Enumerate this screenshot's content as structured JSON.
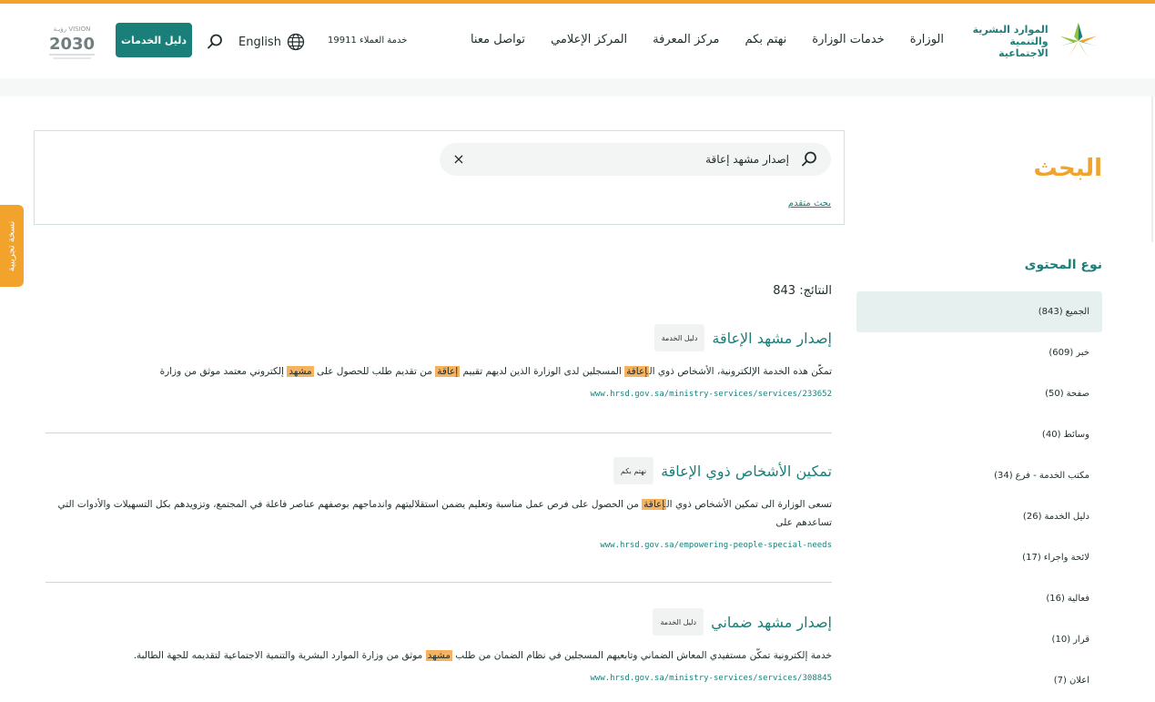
{
  "colors": {
    "accent": "#f2a32c",
    "brand": "#1b7f79",
    "highlight": "#f5b25f"
  },
  "header": {
    "logo_line1": "الموارد البشرية",
    "logo_line2": "والتنمية الاجتماعية",
    "nav": [
      "الوزارة",
      "خدمات الوزارة",
      "نهتم بكم",
      "مركز المعرفة",
      "المركز الإعلامي",
      "تواصل معنا"
    ],
    "customer_service": "خدمة العملاء 19911",
    "language": "English",
    "services_button": "دليل الخدمات",
    "vision_top": "VISION رؤيـة",
    "vision_year": "2030"
  },
  "sidebar": {
    "title": "البحث",
    "filter_title": "نوع المحتوى",
    "filters": [
      {
        "label": "الجميع",
        "count": "(843)"
      },
      {
        "label": "خبر",
        "count": "(609)"
      },
      {
        "label": "صفحة",
        "count": "(50)"
      },
      {
        "label": "وسائط",
        "count": "(40)"
      },
      {
        "label": "مكتب الخدمة - فرع",
        "count": "(34)"
      },
      {
        "label": "دليل الخدمة",
        "count": "(26)"
      },
      {
        "label": "لائحة واجراء",
        "count": "(17)"
      },
      {
        "label": "فعالية",
        "count": "(16)"
      },
      {
        "label": "قرار",
        "count": "(10)"
      },
      {
        "label": "اعلان",
        "count": "(7)"
      }
    ]
  },
  "search": {
    "value": "إصدار مشهد إعاقة",
    "clear": "×",
    "advanced": "بحث متقدم"
  },
  "results_count_label": "النتائج: 843",
  "results": [
    {
      "title": "إصدار مشهد الإعاقة",
      "badge": "دليل الخدمة",
      "desc_parts": [
        "تمكّن هذه الخدمة الإلكترونية، الأشخاص ذوي ال",
        "إعاقة",
        " المسجلين لدى الوزارة الذين لديهم تقييم ",
        "إعاقة",
        " من تقديم طلب للحصول على ",
        "مشهد",
        " إلكتروني معتمد موثق من وزارة"
      ],
      "url": "www.hrsd.gov.sa/ministry-services/services/233652"
    },
    {
      "title": "تمكين الأشخاص ذوي الإعاقة",
      "badge": "نهتم بكم",
      "desc_parts": [
        "تسعى الوزارة الى تمكين الأشخاص ذوي ال",
        "إعاقة",
        " من الحصول على فرص عمل مناسبة وتعليم يضمن استقلاليتهم واندماجهم بوصفهم عناصر فاعلة في المجتمع، وتزويدهم بكل التسهيلات والأدوات التي تساعدهم على"
      ],
      "url": "www.hrsd.gov.sa/empowering-people-special-needs"
    },
    {
      "title": "إصدار مشهد ضماني",
      "badge": "دليل الخدمة",
      "desc_parts": [
        "خدمة إلكترونية تمكّن مستفيدي المعاش الضماني وتابعيهم المسجلين في نظام الضمان من طلب ",
        "مشهد",
        " موثق من وزارة الموارد البشرية والتنمية الاجتماعية لتقديمه للجهة الطالبة."
      ],
      "url": "www.hrsd.gov.sa/ministry-services/services/308845"
    }
  ],
  "side_tab": "نسخة تجريبية"
}
